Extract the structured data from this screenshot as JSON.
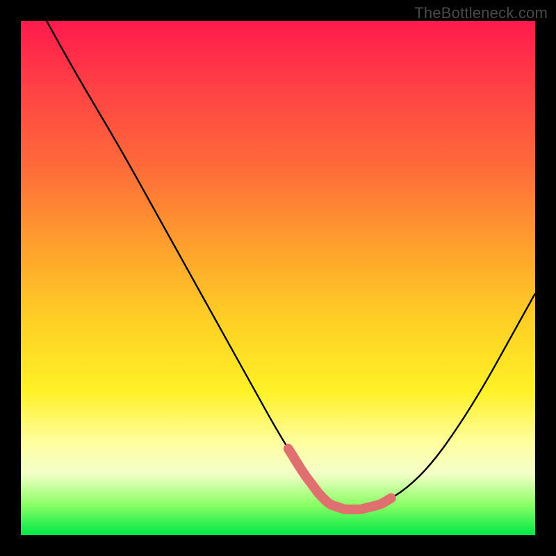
{
  "watermark": "TheBottleneck.com",
  "chart_data": {
    "type": "line",
    "title": "",
    "xlabel": "",
    "ylabel": "",
    "xlim": [
      0,
      100
    ],
    "ylim": [
      0,
      100
    ],
    "series": [
      {
        "name": "curve",
        "x": [
          5,
          10,
          15,
          20,
          25,
          30,
          35,
          40,
          45,
          50,
          55,
          58,
          60,
          63,
          66,
          70,
          75,
          80,
          85,
          90,
          95,
          100
        ],
        "y": [
          100,
          91,
          82.5,
          74,
          65,
          56,
          47,
          38,
          29,
          20,
          12,
          8,
          6,
          5,
          5,
          6,
          9,
          14,
          21,
          29,
          38,
          47
        ]
      },
      {
        "name": "highlight-band",
        "x": [
          52,
          72
        ],
        "y": [
          9,
          9
        ]
      }
    ],
    "colors": {
      "curve": "#000000",
      "highlight": "#e06f6f"
    }
  }
}
